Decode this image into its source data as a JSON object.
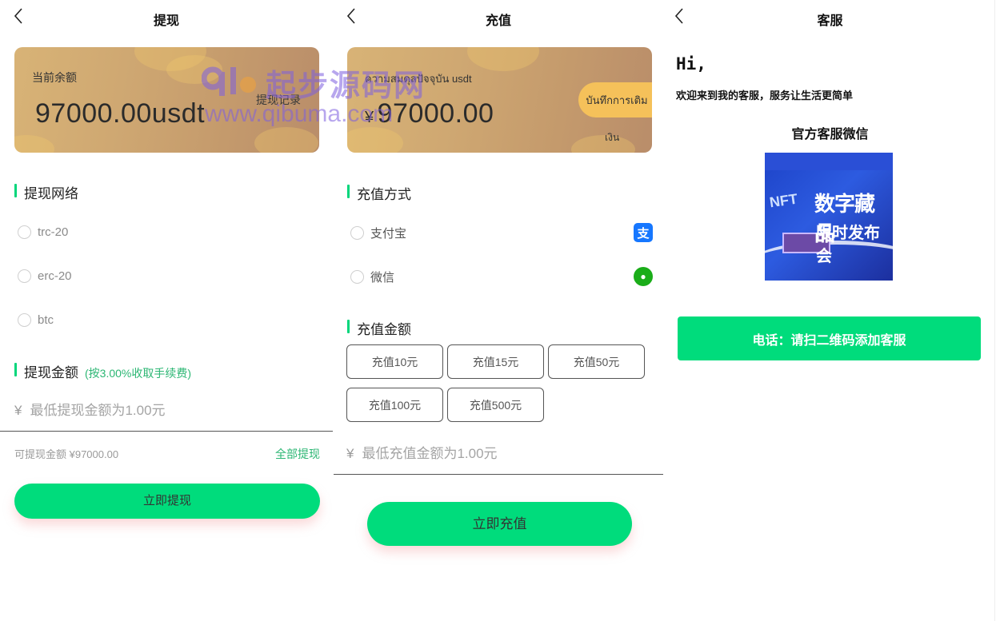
{
  "withdraw": {
    "title": "提现",
    "balance_label": "当前余额",
    "balance_amount": "97000.00usdt",
    "record_button": "提现记录",
    "network_section": "提现网络",
    "networks": [
      "trc-20",
      "erc-20",
      "btc"
    ],
    "amount_section": "提现金额",
    "fee_note": "(按3.00%收取手续费)",
    "currency_symbol": "¥",
    "amount_placeholder": "最低提现金额为1.00元",
    "available_text": "可提现金额 ¥97000.00",
    "withdraw_all": "全部提现",
    "submit_button": "立即提现"
  },
  "recharge": {
    "title": "充值",
    "balance_label": "ความสมดุลปัจจุบัน usdt",
    "currency_symbol": "¥",
    "balance_amount": "97000.00",
    "record_button_line1": "บันทึกการเติม",
    "record_button_line2": "เงิน",
    "method_section": "充值方式",
    "methods": [
      {
        "label": "支付宝",
        "icon": "alipay-icon",
        "color": "#1677ff",
        "glyph": "支"
      },
      {
        "label": "微信",
        "icon": "wechat-icon",
        "color": "#1aad19",
        "glyph": "●"
      }
    ],
    "amount_section": "充值金额",
    "presets": [
      "充值10元",
      "充值15元",
      "充值50元",
      "充值100元",
      "充值500元"
    ],
    "amount_placeholder": "最低充值金额为1.00元",
    "submit_button": "立即充值"
  },
  "service": {
    "title": "客服",
    "greeting": "Hi,",
    "welcome": "欢迎来到我的客服，服务让生活更简单",
    "wechat_title": "官方客服微信",
    "image_text_1": "数字藏品",
    "image_text_2": "限时发布会",
    "image_text_nft": "NFT",
    "phone_button": "电话：请扫二维码添加客服"
  },
  "watermark": {
    "brand": "起步源码网",
    "url": "www.qibuma.com"
  },
  "colors": {
    "accent_green": "#00dc7c",
    "note_green": "#2bb673",
    "card_gold": "#cfa872",
    "record_yellow": "#f5c15a"
  }
}
